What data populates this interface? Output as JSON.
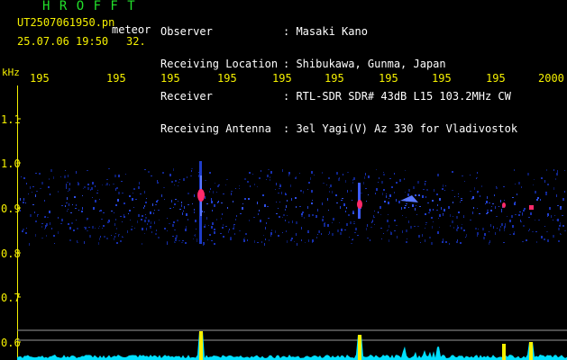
{
  "header": {
    "title": "H R O F F T",
    "filename": "UT2507061950.pn",
    "meteor_label": "meteor",
    "datetime": "25.07.06 19:50",
    "count": "32.",
    "info": [
      {
        "label": "Observer",
        "value": ": Masaki Kano"
      },
      {
        "label": "Receiving Location",
        "value": ": Shibukawa, Gunma, Japan"
      },
      {
        "label": "Receiver",
        "value": ": RTL-SDR SDR# 43dB L15 103.2MHz CW"
      },
      {
        "label": "Receiving Antenna",
        "value": ": 3el Yagi(V) Az 330 for Vladivostok"
      }
    ]
  },
  "axis": {
    "unit": "kHz",
    "x_ticks": [
      "195",
      "195",
      "195",
      "195",
      "195",
      "195",
      "195",
      "195",
      "195",
      "2000"
    ],
    "y_ticks": [
      "1.1",
      "1.0",
      "0.9",
      "0.8",
      "0.7",
      "0.6"
    ]
  },
  "colors": {
    "header_green": "#22e02a",
    "axis_yellow": "#f5f000",
    "spectrum_blue": "#1e3cc8",
    "meteor_red": "#ff2a6a",
    "level_cyan": "#00e0ff"
  }
}
